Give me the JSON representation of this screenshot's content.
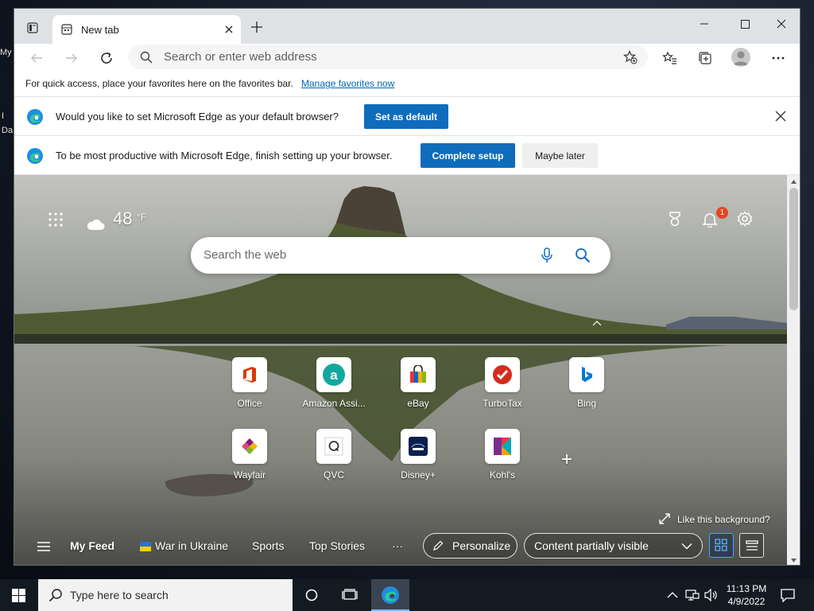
{
  "desktop": {
    "left_fragments": [
      "My",
      "I",
      "Da"
    ]
  },
  "browser": {
    "tab_title": "New tab",
    "address_placeholder": "Search or enter web address",
    "favorites_bar": {
      "message": "For quick access, place your favorites here on the favorites bar.",
      "link": "Manage favorites now"
    },
    "infobar_default": {
      "message": "Would you like to set Microsoft Edge as your default browser?",
      "button": "Set as default"
    },
    "infobar_setup": {
      "message": "To be most productive with Microsoft Edge, finish setting up your browser.",
      "primary_button": "Complete setup",
      "secondary_button": "Maybe later"
    }
  },
  "new_tab_page": {
    "weather": {
      "temperature": "48",
      "unit": "°F",
      "icon": "cloud-icon"
    },
    "notification_count": "1",
    "search_placeholder": "Search the web",
    "quick_links": [
      {
        "label": "Office",
        "icon": "office-icon",
        "color": "#d83b01"
      },
      {
        "label": "Amazon Assi...",
        "icon": "amazon-assistant-icon",
        "color": "#13a89e"
      },
      {
        "label": "eBay",
        "icon": "ebay-icon",
        "color": "#e53238"
      },
      {
        "label": "TurboTax",
        "icon": "turbotax-icon",
        "color": "#d52b1e"
      },
      {
        "label": "Bing",
        "icon": "bing-icon",
        "color": "#0078d4"
      },
      {
        "label": "Wayfair",
        "icon": "wayfair-icon",
        "color": "#7f187f"
      },
      {
        "label": "QVC",
        "icon": "qvc-icon",
        "color": "#333333"
      },
      {
        "label": "Disney+",
        "icon": "disney-plus-icon",
        "color": "#0b1f4f"
      },
      {
        "label": "Kohl's",
        "icon": "kohls-icon",
        "color": "#7b2d8e"
      }
    ],
    "add_tile_symbol": "+",
    "background_prompt": "Like this background?",
    "feed": {
      "my_feed": "My Feed",
      "topics": [
        "War in Ukraine",
        "Sports",
        "Top Stories"
      ],
      "more": "···",
      "personalize": "Personalize",
      "visibility": "Content partially visible"
    }
  },
  "taskbar": {
    "search_placeholder": "Type here to search",
    "time": "11:13 PM",
    "date": "4/9/2022"
  },
  "colors": {
    "edge_blue": "#0f6cbd",
    "notification_badge": "#e8441f",
    "taskbar": "#141a22"
  }
}
